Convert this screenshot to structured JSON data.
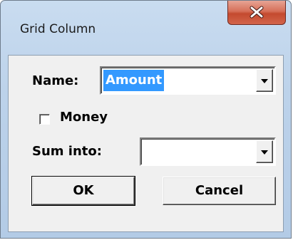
{
  "window": {
    "title": "Grid Column"
  },
  "form": {
    "name_label": "Name:",
    "name_value": "Amount",
    "money_label": "Money",
    "money_checked": false,
    "sum_into_label": "Sum into:",
    "sum_into_value": ""
  },
  "buttons": {
    "ok_label": "OK",
    "cancel_label": "Cancel"
  },
  "colors": {
    "selection": "#3399ff",
    "close_button": "#c44a2f",
    "frame": "#bcd2ea",
    "client": "#f0f0f0"
  },
  "icons": {
    "close": "close-icon",
    "dropdown": "chevron-down-icon"
  }
}
